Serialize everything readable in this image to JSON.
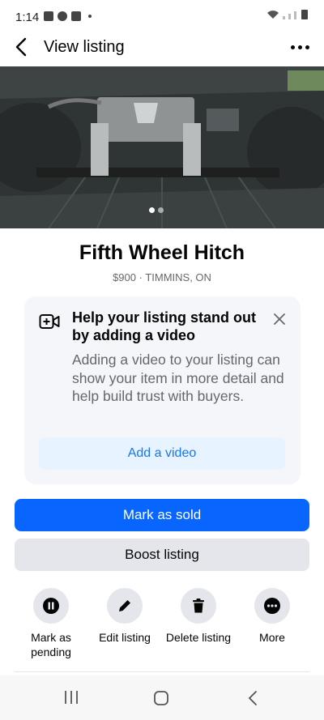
{
  "status_bar": {
    "time": "1:14"
  },
  "header": {
    "title": "View listing"
  },
  "listing": {
    "title": "Fifth Wheel Hitch",
    "meta": "$900 · TIMMINS, ON",
    "photo_count": 2,
    "active_photo": 1
  },
  "promo": {
    "heading": "Help your listing stand out by adding a video",
    "body": "Adding a video to your listing can show your item in more detail and help build trust with buyers.",
    "button": "Add a video"
  },
  "buttons": {
    "mark_sold": "Mark as sold",
    "boost": "Boost listing"
  },
  "actions": [
    {
      "label": "Mark as pending",
      "icon": "pause-icon"
    },
    {
      "label": "Edit listing",
      "icon": "pencil-icon"
    },
    {
      "label": "Delete listing",
      "icon": "trash-icon"
    },
    {
      "label": "More",
      "icon": "more-horizontal-icon"
    }
  ],
  "colors": {
    "primary": "#0866ff",
    "link": "#1877f2",
    "secondary_bg": "#e4e6eb",
    "muted_text": "#65676b"
  }
}
